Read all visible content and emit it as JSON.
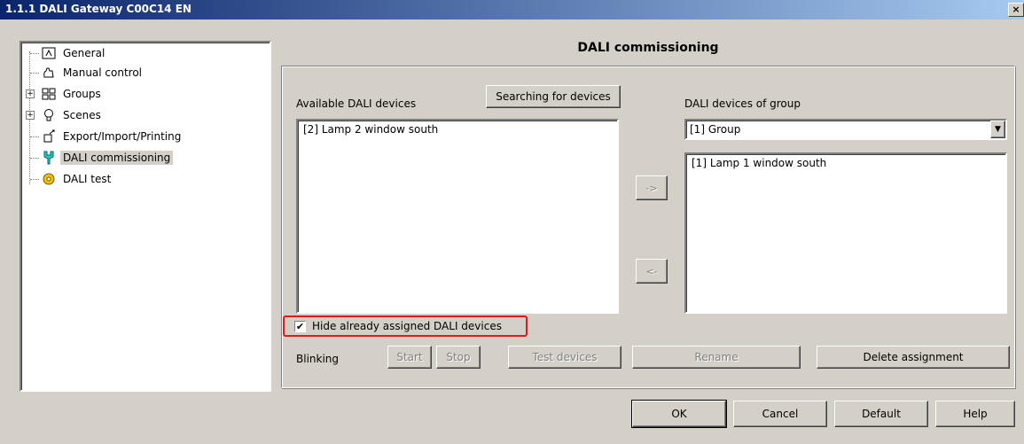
{
  "window": {
    "title": "1.1.1 DALI Gateway C00C14 EN",
    "close_glyph": "×"
  },
  "tree": {
    "items": [
      {
        "label": "General",
        "icon": "general-icon"
      },
      {
        "label": "Manual control",
        "icon": "hand-icon"
      },
      {
        "label": "Groups",
        "icon": "groups-icon",
        "expander": "+"
      },
      {
        "label": "Scenes",
        "icon": "bulb-icon",
        "expander": "+"
      },
      {
        "label": "Export/Import/Printing",
        "icon": "export-icon"
      },
      {
        "label": "DALI commissioning",
        "icon": "commissioning-icon",
        "selected": true
      },
      {
        "label": "DALI test",
        "icon": "test-icon"
      }
    ]
  },
  "panel": {
    "heading": "DALI commissioning",
    "available_label": "Available DALI devices",
    "search_button": "Searching for devices",
    "available_devices": [
      "[2] Lamp 2 window south"
    ],
    "group_label": "DALI devices of group",
    "group_select_value": "[1] Group",
    "group_devices": [
      "[1] Lamp 1 window south"
    ],
    "move_right": "->",
    "move_left": "<-",
    "hide_assigned_label": "Hide already assigned DALI devices",
    "hide_assigned_checked": "✔",
    "blinking_label": "Blinking",
    "start": "Start",
    "stop": "Stop",
    "test_devices": "Test devices",
    "rename": "Rename",
    "delete_assignment": "Delete assignment"
  },
  "footer": {
    "ok": "OK",
    "cancel": "Cancel",
    "default": "Default",
    "help": "Help"
  },
  "colors": {
    "titlebar_start": "#0a246a",
    "titlebar_end": "#a6caf0",
    "highlight": "#e0191f",
    "face": "#d4d0c8"
  }
}
